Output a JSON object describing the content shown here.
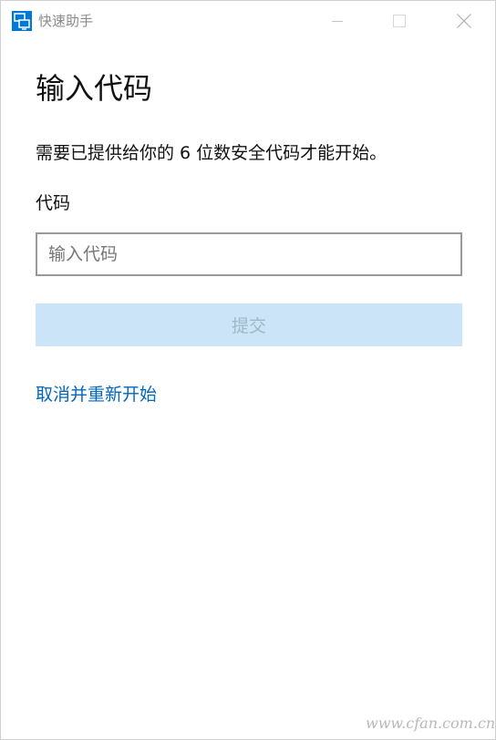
{
  "window": {
    "title": "快速助手",
    "icon": "quick-assist-monitor-icon",
    "controls": {
      "minimize_icon": "minimize-icon",
      "maximize_icon": "maximize-icon",
      "close_icon": "close-icon"
    }
  },
  "main": {
    "heading": "输入代码",
    "description": "需要已提供给你的 6 位数安全代码才能开始。",
    "code_label": "代码",
    "code_input": {
      "placeholder": "输入代码",
      "value": ""
    },
    "submit_label": "提交",
    "restart_link": "取消并重新开始"
  },
  "watermark": "www.cfan.com.cn",
  "colors": {
    "accent": "#0067c0",
    "disabled_button_bg": "#cce4f7",
    "app_icon_bg": "#0078d7"
  }
}
